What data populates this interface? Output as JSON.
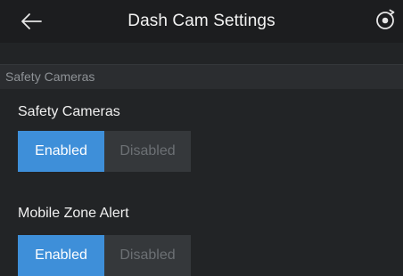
{
  "header": {
    "title": "Dash Cam Settings",
    "back_icon": "arrow-left-icon",
    "menu_icon": "target-circle-icon"
  },
  "section": {
    "title": "Safety Cameras"
  },
  "settings": [
    {
      "label": "Safety Cameras",
      "options": [
        "Enabled",
        "Disabled"
      ],
      "selected": "Enabled"
    },
    {
      "label": "Mobile Zone Alert",
      "options": [
        "Enabled",
        "Disabled"
      ],
      "selected": "Enabled"
    }
  ],
  "colors": {
    "accent": "#3e8fd9",
    "background": "#222426",
    "header": "#1c1d1f",
    "inactive_segment": "#35383b"
  }
}
